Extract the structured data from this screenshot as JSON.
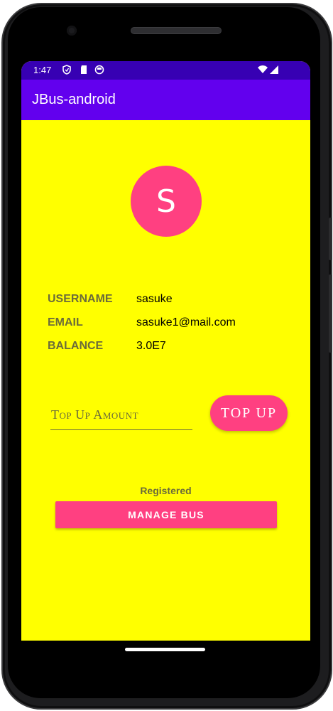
{
  "status_bar": {
    "time": "1:47",
    "icons": [
      "shield-icon",
      "sd-card-icon",
      "circle-status-icon"
    ],
    "right_icons": [
      "wifi-icon",
      "signal-icon"
    ]
  },
  "app_bar": {
    "title": "JBus-android"
  },
  "profile": {
    "avatar_initial": "S",
    "username_label": "USERNAME",
    "username_value": "sasuke",
    "email_label": "EMAIL",
    "email_value": "sasuke1@mail.com",
    "balance_label": "BALANCE",
    "balance_value": "3.0E7"
  },
  "topup": {
    "placeholder": "Top Up Amount",
    "value": "",
    "button_label": "TOP UP"
  },
  "registration": {
    "status_text": "Registered",
    "manage_bus_label": "MANAGE BUS"
  },
  "colors": {
    "status_bar": "#3700b3",
    "app_bar": "#6200ee",
    "background": "#ffff00",
    "accent": "#ff4081",
    "label_text": "#6b6b3a"
  }
}
